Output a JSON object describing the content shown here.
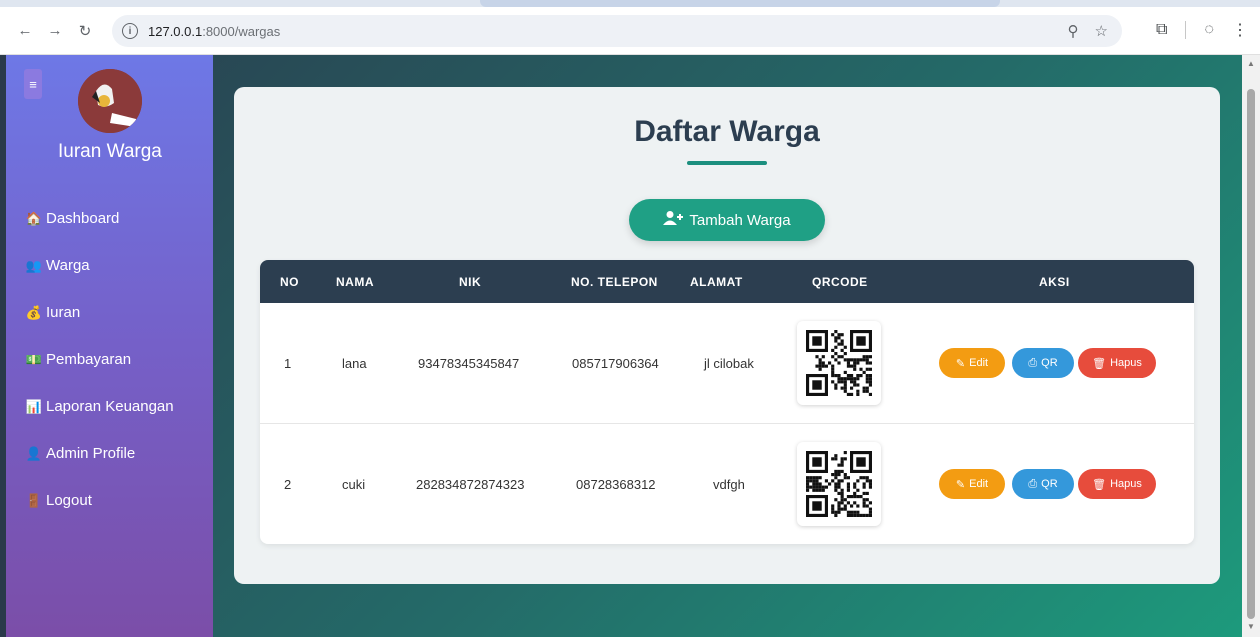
{
  "browser": {
    "url_host": "127.0.0.1",
    "url_path": ":8000/wargas"
  },
  "sidebar": {
    "brand": "Iuran Warga",
    "items": [
      {
        "label": "Dashboard",
        "icon": "home-icon"
      },
      {
        "label": "Warga",
        "icon": "people-icon"
      },
      {
        "label": "Iuran",
        "icon": "money-bag-icon"
      },
      {
        "label": "Pembayaran",
        "icon": "cash-icon"
      },
      {
        "label": "Laporan Keuangan",
        "icon": "chart-icon"
      },
      {
        "label": "Admin Profile",
        "icon": "user-icon"
      },
      {
        "label": "Logout",
        "icon": "door-icon"
      }
    ]
  },
  "main": {
    "title": "Daftar Warga",
    "add_button": "Tambah Warga",
    "columns": [
      "NO",
      "NAMA",
      "NIK",
      "NO. TELEPON",
      "ALAMAT",
      "QRCODE",
      "AKSI"
    ],
    "rows": [
      {
        "no": "1",
        "nama": "lana",
        "nik": "93478345345847",
        "telepon": "085717906364",
        "alamat": "jl cilobak"
      },
      {
        "no": "2",
        "nama": "cuki",
        "nik": "282834872874323",
        "telepon": "08728368312",
        "alamat": "vdfgh"
      }
    ],
    "actions": {
      "edit": "Edit",
      "qr": "QR",
      "delete": "Hapus"
    }
  },
  "colors": {
    "header": "#2c3e50",
    "accent": "#1fa085",
    "edit": "#f39c12",
    "qr": "#3498db",
    "delete": "#e74c3c"
  }
}
